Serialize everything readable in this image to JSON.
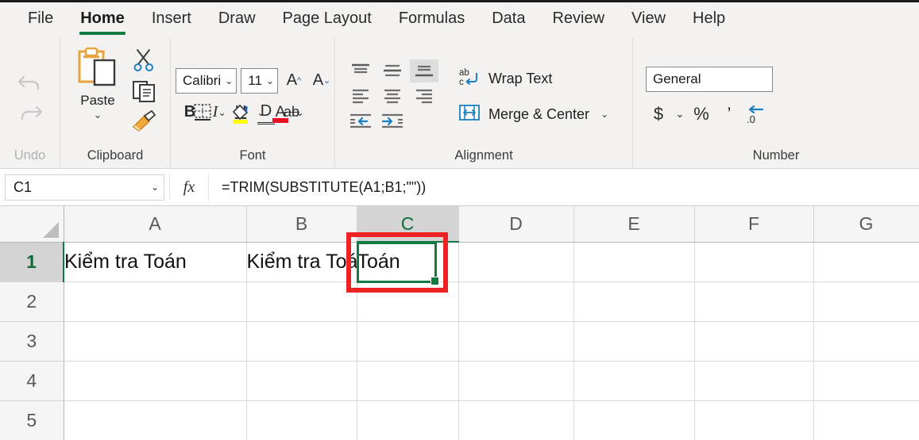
{
  "ribbon": {
    "tabs": [
      {
        "label": "File",
        "active": false
      },
      {
        "label": "Home",
        "active": true
      },
      {
        "label": "Insert",
        "active": false
      },
      {
        "label": "Draw",
        "active": false
      },
      {
        "label": "Page Layout",
        "active": false
      },
      {
        "label": "Formulas",
        "active": false
      },
      {
        "label": "Data",
        "active": false
      },
      {
        "label": "Review",
        "active": false
      },
      {
        "label": "View",
        "active": false
      },
      {
        "label": "Help",
        "active": false
      }
    ],
    "accent_color": "#107c41",
    "groups": {
      "undo": {
        "label": "Undo",
        "disabled": true
      },
      "clipboard": {
        "label": "Clipboard",
        "paste_label": "Paste",
        "cut_icon": "scissors-icon",
        "copy_icon": "copy-icon",
        "format_painter_icon": "format-painter-icon"
      },
      "font": {
        "label": "Font",
        "font_name": "Calibri",
        "font_size": "11",
        "bold": "B",
        "italic": "I",
        "underline": "U",
        "double_underline": "D",
        "strikethrough": "ab",
        "grow_font": "A",
        "shrink_font": "A",
        "fill_color": "#ffff00",
        "font_color": "#e81123"
      },
      "alignment": {
        "label": "Alignment",
        "wrap_text_label": "Wrap Text",
        "merge_center_label": "Merge & Center",
        "selected_vertical_align": "bottom"
      },
      "number": {
        "label": "Number",
        "format": "General",
        "currency": "$",
        "percent": "%",
        "comma": "’"
      }
    }
  },
  "formula_bar": {
    "name_box": "C1",
    "fx_label": "fx",
    "formula": "=TRIM(SUBSTITUTE(A1;B1;\"\"))"
  },
  "sheet": {
    "columns": [
      "A",
      "B",
      "C",
      "D",
      "E",
      "F",
      "G"
    ],
    "rows": [
      "1",
      "2",
      "3",
      "4",
      "5"
    ],
    "active_cell": "C1",
    "active_column": "C",
    "active_row": "1",
    "cells": [
      [
        "Kiểm tra Toán",
        "Kiểm tra Toán",
        "Toán",
        "",
        "",
        "",
        ""
      ],
      [
        "",
        "",
        "",
        "",
        "",
        "",
        ""
      ],
      [
        "",
        "",
        "",
        "",
        "",
        "",
        ""
      ],
      [
        "",
        "",
        "",
        "",
        "",
        "",
        ""
      ],
      [
        "",
        "",
        "",
        "",
        "",
        "",
        ""
      ]
    ],
    "annotation_color": "#ee2222",
    "selection_color": "#117b42"
  }
}
